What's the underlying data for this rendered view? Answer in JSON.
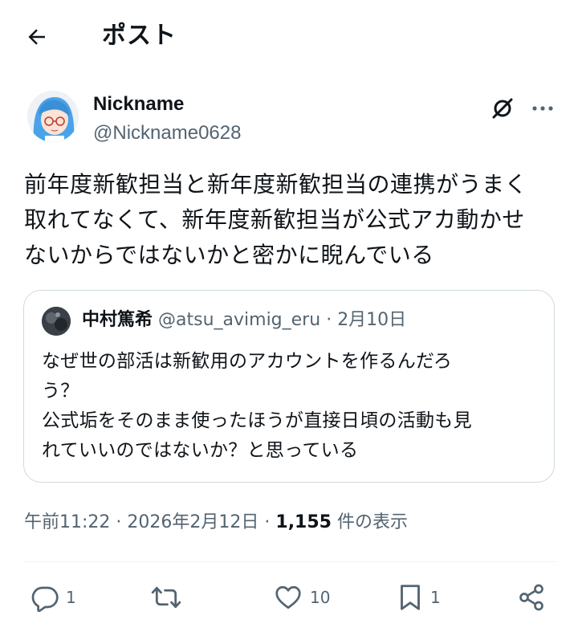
{
  "header": {
    "title": "ポスト"
  },
  "post": {
    "author": {
      "display_name": "Nickname",
      "handle": "@Nickname0628"
    },
    "text": "前年度新歓担当と新年度新歓担当の連携がうまく\n取れてなくて、新年度新歓担当が公式アカ動かせ\nないからではないかと密かに睨んでいる",
    "quote": {
      "author_name": "中村篤希",
      "handle": "@atsu_avimig_eru",
      "separator": "·",
      "date": "2月10日",
      "text": "なぜ世の部活は新歓用のアカウントを作るんだろ\nう？\n公式垢をそのまま使ったほうが直接日頃の活動も見\nれていいのではないか？と思っている"
    },
    "meta": {
      "time": "午前11:22",
      "separator1": "·",
      "date": "2026年2月12日",
      "separator2": "·",
      "views_count": "1,155",
      "views_label": "件の表示"
    },
    "actions": {
      "reply_count": "1",
      "repost_count": "",
      "like_count": "10",
      "bookmark_count": "1"
    }
  },
  "colors": {
    "text": "#0f1419",
    "secondary": "#536471",
    "border": "#cfd9de"
  },
  "icons": [
    "back-arrow-icon",
    "grok-icon",
    "more-icon",
    "reply-icon",
    "repost-icon",
    "like-icon",
    "bookmark-icon",
    "share-icon"
  ]
}
